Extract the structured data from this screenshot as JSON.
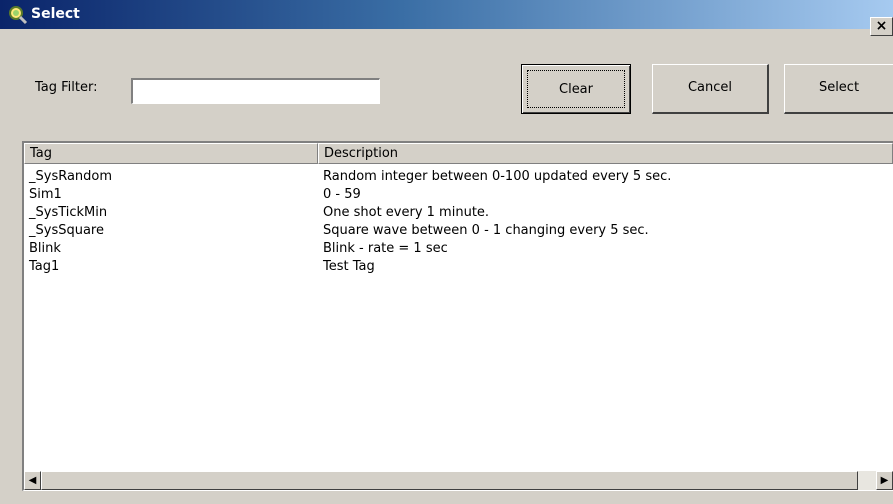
{
  "window": {
    "title": "Select",
    "close_label": "×"
  },
  "filter": {
    "label": "Tag Filter:",
    "value": "",
    "placeholder": ""
  },
  "buttons": {
    "clear": "Clear",
    "cancel": "Cancel",
    "select": "Select"
  },
  "table": {
    "columns": [
      "Tag",
      "Description"
    ],
    "rows": [
      {
        "tag": "_SysRandom",
        "description": "Random integer between 0-100 updated every 5 sec."
      },
      {
        "tag": "Sim1",
        "description": "0 - 59"
      },
      {
        "tag": "_SysTickMin",
        "description": "One shot every 1 minute."
      },
      {
        "tag": "_SysSquare",
        "description": "Square wave between 0 - 1 changing every 5 sec."
      },
      {
        "tag": "Blink",
        "description": "Blink - rate = 1 sec"
      },
      {
        "tag": "Tag1",
        "description": "Test Tag"
      }
    ]
  },
  "scrollbar": {
    "left_arrow": "◀",
    "right_arrow": "▶"
  },
  "icons": {
    "title_icon": "search-tag-icon"
  }
}
